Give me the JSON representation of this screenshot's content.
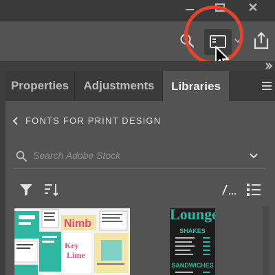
{
  "colors": {
    "titlebar": "#3a3a3a",
    "panel_background": "#535353",
    "highlight_ring": "#e4452a",
    "accent_teal": "#2fb7a1"
  },
  "window_controls": {
    "icons": [
      "minimize-icon",
      "maximize-icon",
      "close-icon"
    ],
    "close_glyph": "✕"
  },
  "toolbar": {
    "icons": [
      "search-icon",
      "panel-layout-icon",
      "chevron-down-icon",
      "share-icon"
    ]
  },
  "tabs": [
    {
      "label": "Properties",
      "active": false
    },
    {
      "label": "Adjustments",
      "active": false
    },
    {
      "label": "Libraries",
      "active": true
    }
  ],
  "library": {
    "back_glyph": "‹",
    "name": "FONTS FOR PRINT DESIGN",
    "search_placeholder": "Search Adobe Stock"
  },
  "view_controls": {
    "icons": [
      "filter-icon",
      "sort-icon",
      "grid-view-icon",
      "list-view-icon"
    ]
  },
  "thumbnails": [
    {
      "name": "typography-collage",
      "title_text": "Nimb",
      "key_text": "Key Lime"
    },
    {
      "name": "lounge-menu",
      "title_text": "Lounge",
      "section_1": "SHAKES",
      "section_2": "SANDWICHES"
    }
  ]
}
